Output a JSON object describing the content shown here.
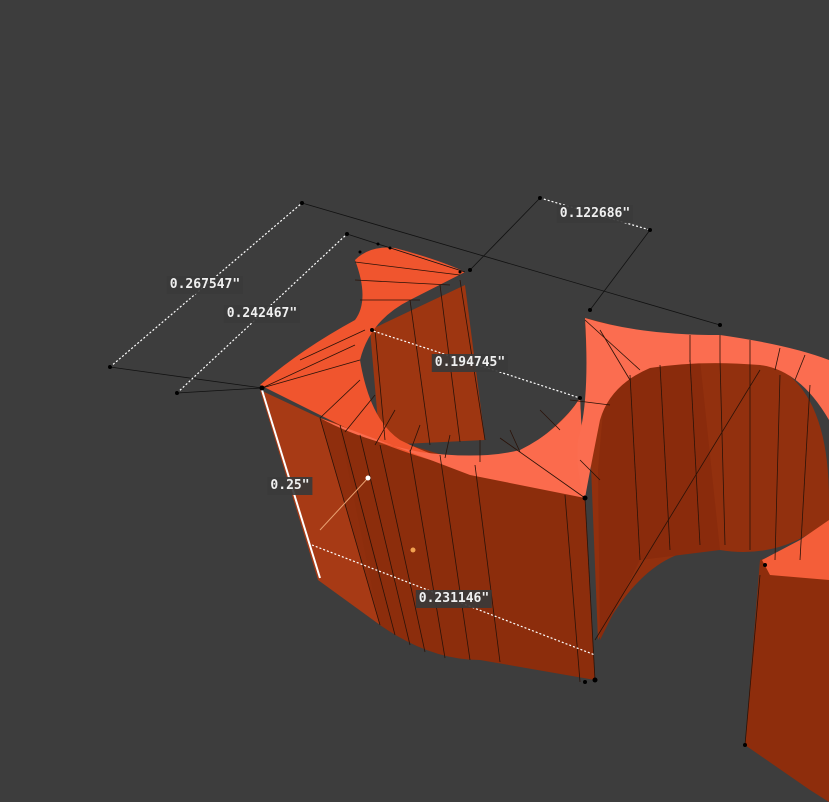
{
  "viewport": {
    "background_color": "#3d3d3d",
    "object_colors": {
      "top_face_light": "#fa6b4f",
      "top_face_mid": "#f25a33",
      "side_face_lit": "#b8411d",
      "side_face_dark": "#8b2c0c",
      "inner_wall": "#a1380f"
    }
  },
  "dimensions": [
    {
      "id": "dim-width-outer",
      "value": "0.267547\""
    },
    {
      "id": "dim-width-inner",
      "value": "0.242467\""
    },
    {
      "id": "dim-gap",
      "value": "0.122686\""
    },
    {
      "id": "dim-hole",
      "value": "0.194745\""
    },
    {
      "id": "dim-height",
      "value": "0.25\""
    },
    {
      "id": "dim-depth",
      "value": "0.231146\""
    }
  ]
}
